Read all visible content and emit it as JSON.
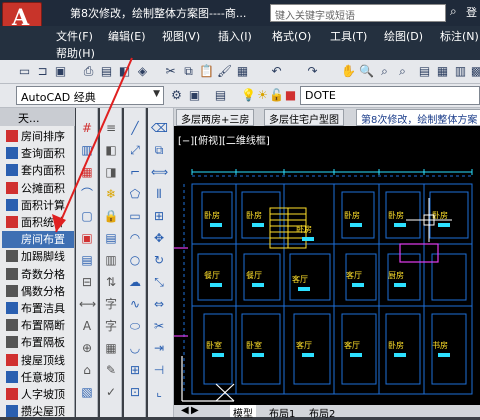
{
  "app": {
    "logo_letter": "A",
    "caret": "▼"
  },
  "title": {
    "document": "第8次修改，绘制整体方案图----商...",
    "search_placeholder": "键入关键字或短语",
    "signin_label": "登"
  },
  "menu": [
    "文件(F)",
    "编辑(E)",
    "视图(V)",
    "插入(I)",
    "格式(O)",
    "工具(T)",
    "绘图(D)",
    "标注(N)"
  ],
  "menu_row2": [
    "帮助(H)"
  ],
  "workspace": {
    "value": "AutoCAD 经典"
  },
  "layer_combo": {
    "value": "DOTE"
  },
  "palette": {
    "header": "天...",
    "items": [
      {
        "label": "房间排序",
        "icon_color": "#d03030"
      },
      {
        "label": "查询面积",
        "icon_color": "#2a5fb0"
      },
      {
        "label": "套内面积",
        "icon_color": "#2a5fb0"
      },
      {
        "label": "公摊面积",
        "icon_color": "#d03030"
      },
      {
        "label": "面积计算",
        "icon_color": "#2a5fb0"
      },
      {
        "label": "面积统计",
        "icon_color": "#d03030"
      },
      {
        "label": "房间布置",
        "icon_color": "#3e6fb3"
      },
      {
        "label": "加踢脚线",
        "icon_color": "#555555"
      },
      {
        "label": "奇数分格",
        "icon_color": "#555555"
      },
      {
        "label": "偶数分格",
        "icon_color": "#555555"
      },
      {
        "label": "布置洁具",
        "icon_color": "#2a5fb0"
      },
      {
        "label": "布置隔断",
        "icon_color": "#555555"
      },
      {
        "label": "布置隔板",
        "icon_color": "#555555"
      },
      {
        "label": "搜屋顶线",
        "icon_color": "#d03030"
      },
      {
        "label": "任意坡顶",
        "icon_color": "#2a5fb0"
      },
      {
        "label": "人字坡顶",
        "icon_color": "#d03030"
      },
      {
        "label": "攒尖屋顶",
        "icon_color": "#2a5fb0"
      }
    ]
  },
  "doc_tabs": [
    "多层两房+三房",
    "多层住宅户型图",
    "第8次修改，绘制整体方案"
  ],
  "viewport_label": "[−][俯视][二维线框]",
  "layout_tabs": [
    "模型",
    "布局1",
    "布局2"
  ],
  "rooms": [
    "卧房",
    "卧房",
    "卧房",
    "卧房",
    "卧房",
    "卧房",
    "餐厅",
    "餐厅",
    "客厅",
    "客厅",
    "厨房",
    "卧室",
    "卧室",
    "客厅",
    "客厅",
    "卧房",
    "书房"
  ],
  "colors": {
    "accent": "#c8342a",
    "cad_line": "#1e6fd9",
    "cad_cyan": "#2de0ff",
    "cad_yellow": "#ffe02a",
    "cad_magenta": "#e33cf0",
    "arrow": "#e02020"
  }
}
